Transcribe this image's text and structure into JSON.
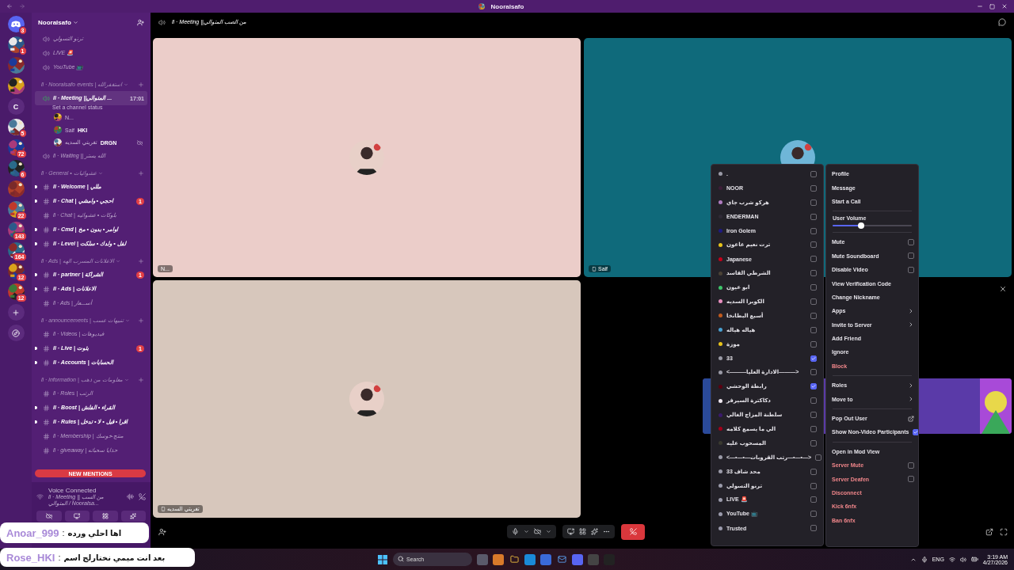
{
  "window": {
    "title": "Nooralsafo"
  },
  "servers": [
    {
      "kind": "home",
      "badge": "3"
    },
    {
      "kind": "avatar",
      "badge": "1"
    },
    {
      "kind": "avatar"
    },
    {
      "kind": "avatar"
    },
    {
      "kind": "letter",
      "letter": "C"
    },
    {
      "kind": "avatar",
      "badge": "5"
    },
    {
      "kind": "avatar",
      "badge": "72"
    },
    {
      "kind": "avatar",
      "badge": "6"
    },
    {
      "kind": "avatar"
    },
    {
      "kind": "avatar",
      "badge": "22"
    },
    {
      "kind": "avatar",
      "badge": "143"
    },
    {
      "kind": "avatar",
      "badge": "164"
    },
    {
      "kind": "avatar",
      "badge": "12"
    },
    {
      "kind": "avatar",
      "badge": "12"
    }
  ],
  "server_name": "Nooralsafo",
  "channels": [
    {
      "kind": "voice",
      "name": "ترنو التسولي",
      "selected": false
    },
    {
      "kind": "voice",
      "name": "LIVE 🚨",
      "selected": false
    },
    {
      "kind": "voice",
      "name": "YouTube 📺",
      "selected": false
    },
    {
      "kind": "category",
      "name": "ll · Nooralsafo events | استغفرالله",
      "children": [
        {
          "kind": "voice",
          "name": "ll · Meeting ||المتوالي ...",
          "selected": true,
          "time": "17:01",
          "status": "Set a channel status",
          "members": [
            {
              "name": "N...",
              "video_off": false
            },
            {
              "name": "Saif",
              "tag": "HKI",
              "video_off": false
            },
            {
              "name": "تغريتي السديه",
              "tag": "DRGN",
              "video_off": true
            }
          ]
        },
        {
          "kind": "voice",
          "name": "ll · Waiting || الله يستر",
          "selected": false
        }
      ]
    },
    {
      "kind": "category",
      "name": "ll · General • عشوائيات",
      "children": [
        {
          "kind": "text",
          "name": "ll · Welcome | مللي",
          "unread": true
        },
        {
          "kind": "text",
          "name": "ll · Chat | احجي • وامشي",
          "unread": true,
          "badge": "1"
        },
        {
          "kind": "text",
          "name": "ll · Chat | بلوكات • عشوائيه",
          "unread": false
        },
        {
          "kind": "text",
          "name": "ll · Cmd | اوامر • بدون • مخ",
          "unread": true
        },
        {
          "kind": "text",
          "name": "ll · Level | لفل • ولدك • سلكت",
          "unread": true
        }
      ]
    },
    {
      "kind": "category",
      "name": "ll · Ads | الاعلانات المسرب الهه",
      "children": [
        {
          "kind": "text",
          "name": "ll · partner | الشراكة",
          "unread": true,
          "badge": "1"
        },
        {
          "kind": "text",
          "name": "ll · Ads | الاعلانات",
          "unread": true
        },
        {
          "kind": "text",
          "name": "ll · Ads | أســـعار",
          "unread": false
        }
      ]
    },
    {
      "kind": "category",
      "name": "ll · announcements | تنبيهات عسب",
      "children": [
        {
          "kind": "text",
          "name": "ll · Videos | فيديوهات",
          "unread": false
        },
        {
          "kind": "text",
          "name": "ll · Live | بثوت",
          "unread": true,
          "badge": "1"
        },
        {
          "kind": "text",
          "name": "ll · Accounts | الحسابات",
          "unread": true
        }
      ]
    },
    {
      "kind": "category",
      "name": "ll · information | معلومات من ذهب",
      "children": [
        {
          "kind": "text",
          "name": "ll · Roles | الرتب",
          "unread": false
        },
        {
          "kind": "text",
          "name": "ll · Boost | القراء • الفلش",
          "unread": true
        },
        {
          "kind": "text",
          "name": "ll · Rules | اقرا • قبل • لا • تدخل",
          "unread": true
        },
        {
          "kind": "text",
          "name": "ll · Membership | منتج-خوسك",
          "unread": false
        },
        {
          "kind": "text",
          "name": "ll · giveaway | حذايا سحباته",
          "unread": false
        }
      ]
    }
  ],
  "new_mentions": "NEW MENTIONS",
  "voice_status": {
    "title": "Voice Connected",
    "channel": "ll · Meeting || من السب المتوالي / Nooralsa..."
  },
  "header": {
    "channel": "ll · Meeting ||من الصب المتوالي"
  },
  "tiles": [
    {
      "kind": "participant",
      "name": "N...",
      "color": "#ebcdc9",
      "mobile": false
    },
    {
      "kind": "participant",
      "name": "Saif",
      "color": "#0f6a7b",
      "mobile": true
    },
    {
      "kind": "participant",
      "name": "تغريتي السديه",
      "color": "#d7c7bc",
      "mobile": true
    },
    {
      "kind": "activity"
    }
  ],
  "roles": [
    {
      "name": ".",
      "color": "#9a9aa6",
      "checked": false
    },
    {
      "name": "NOOR",
      "color": "#3d1d38",
      "checked": false
    },
    {
      "name": "هركو شرب جاي",
      "color": "#b07cc0",
      "checked": false
    },
    {
      "name": "ENDERMAN",
      "color": "#2f2a36",
      "checked": false
    },
    {
      "name": "Iron Golem",
      "color": "#1e1a80",
      "checked": false
    },
    {
      "name": "ترت نعيم عاعون",
      "color": "#e8c31a",
      "checked": false
    },
    {
      "name": "Japanese",
      "color": "#c4001a",
      "checked": false
    },
    {
      "name": "الشرطي الفاسد",
      "color": "#4b4236",
      "checked": false
    },
    {
      "name": "ابو عيون",
      "color": "#3ec46a",
      "checked": false
    },
    {
      "name": "الكوبرا السديه",
      "color": "#e88fc0",
      "checked": false
    },
    {
      "name": "أسبع البطانخا",
      "color": "#c05a1e",
      "checked": false
    },
    {
      "name": "هياله هياله",
      "color": "#4aa0d0",
      "checked": false
    },
    {
      "name": "موزة",
      "color": "#e8c31a",
      "checked": false
    },
    {
      "name": "33",
      "color": "#9a9aa6",
      "checked": true
    },
    {
      "name": "<———الادارة العليا———>",
      "color": "#9a9aa6",
      "checked": false
    },
    {
      "name": "رابطة الوحشي",
      "color": "#5a0010",
      "checked": true
    },
    {
      "name": "دكاكترة السيرفر",
      "color": "#f0e8f0",
      "checked": false
    },
    {
      "name": "سلطنة المزاج الغالي",
      "color": "#3a1a6a",
      "checked": false
    },
    {
      "name": "الي ما يسمع كلامه",
      "color": "#a0001a",
      "checked": false
    },
    {
      "name": "المسحوب عليه",
      "color": "#3a3a30",
      "checked": false
    },
    {
      "name": "<—•—•—رتب القروبات—•—•—>",
      "color": "#9a9aa7",
      "checked": false
    },
    {
      "name": "محد شاف 33",
      "color": "#9a9aa8",
      "checked": false
    },
    {
      "name": "ترنو التسولي",
      "color": "#9a9aa9",
      "checked": false
    },
    {
      "name": "LIVE 🚨",
      "color": "#9a9aaa",
      "checked": false
    },
    {
      "name": "YouTube 📺",
      "color": "#9a9aab",
      "checked": false
    },
    {
      "name": "Trusted",
      "color": "#9a9aac",
      "checked": false
    }
  ],
  "menu": [
    {
      "kind": "item",
      "label": "Profile",
      "danger": false
    },
    {
      "kind": "item",
      "label": "Message",
      "danger": false
    },
    {
      "kind": "item",
      "label": "Start a Call",
      "danger": false
    },
    {
      "kind": "separator"
    },
    {
      "kind": "slider",
      "label": "User Volume",
      "level": 0.36,
      "danger": false
    },
    {
      "kind": "separator"
    },
    {
      "kind": "checkbox",
      "label": "Mute",
      "checked": false,
      "danger": false
    },
    {
      "kind": "checkbox",
      "label": "Mute Soundboard",
      "checked": false,
      "danger": false
    },
    {
      "kind": "checkbox",
      "label": "Disable Video",
      "checked": false,
      "danger": false
    },
    {
      "kind": "item",
      "label": "View Verification Code",
      "danger": false
    },
    {
      "kind": "item",
      "label": "Change Nickname",
      "danger": false
    },
    {
      "kind": "submenu",
      "label": "Apps",
      "danger": false
    },
    {
      "kind": "submenu",
      "label": "Invite to Server",
      "danger": false
    },
    {
      "kind": "item",
      "label": "Add Friend",
      "danger": false
    },
    {
      "kind": "item",
      "label": "Ignore",
      "danger": false
    },
    {
      "kind": "item",
      "label": "Block",
      "danger": true
    },
    {
      "kind": "separator"
    },
    {
      "kind": "submenu",
      "label": "Roles",
      "danger": false
    },
    {
      "kind": "submenu",
      "label": "Move to",
      "danger": false
    },
    {
      "kind": "separator"
    },
    {
      "kind": "popout",
      "label": "Pop Out User",
      "danger": false
    },
    {
      "kind": "checkbox",
      "label": "Show Non-Video Participants",
      "checked": true,
      "danger": false
    },
    {
      "kind": "separator"
    },
    {
      "kind": "item",
      "label": "Open in Mod View",
      "danger": false
    },
    {
      "kind": "checkbox",
      "label": "Server Mute",
      "checked": false,
      "danger": true
    },
    {
      "kind": "checkbox",
      "label": "Server Deafen",
      "checked": false,
      "danger": true
    },
    {
      "kind": "item",
      "label": "Disconnect",
      "danger": true
    },
    {
      "kind": "item",
      "label": "Kick 6nfx",
      "danger": true
    },
    {
      "kind": "item",
      "label": "Ban 6nfx",
      "danger": true
    }
  ],
  "stream_chat": [
    {
      "user": "Anoar_999",
      "separator": ":",
      "message": "اها احلي ورده"
    },
    {
      "user": "Rose_HKI",
      "separator": ":",
      "message": "بعد انت ميمي نختارلج اسم"
    }
  ],
  "taskbar": {
    "placeholder": "Search",
    "language": "ENG",
    "time": "3:19 AM",
    "date": "4/27/2026"
  }
}
